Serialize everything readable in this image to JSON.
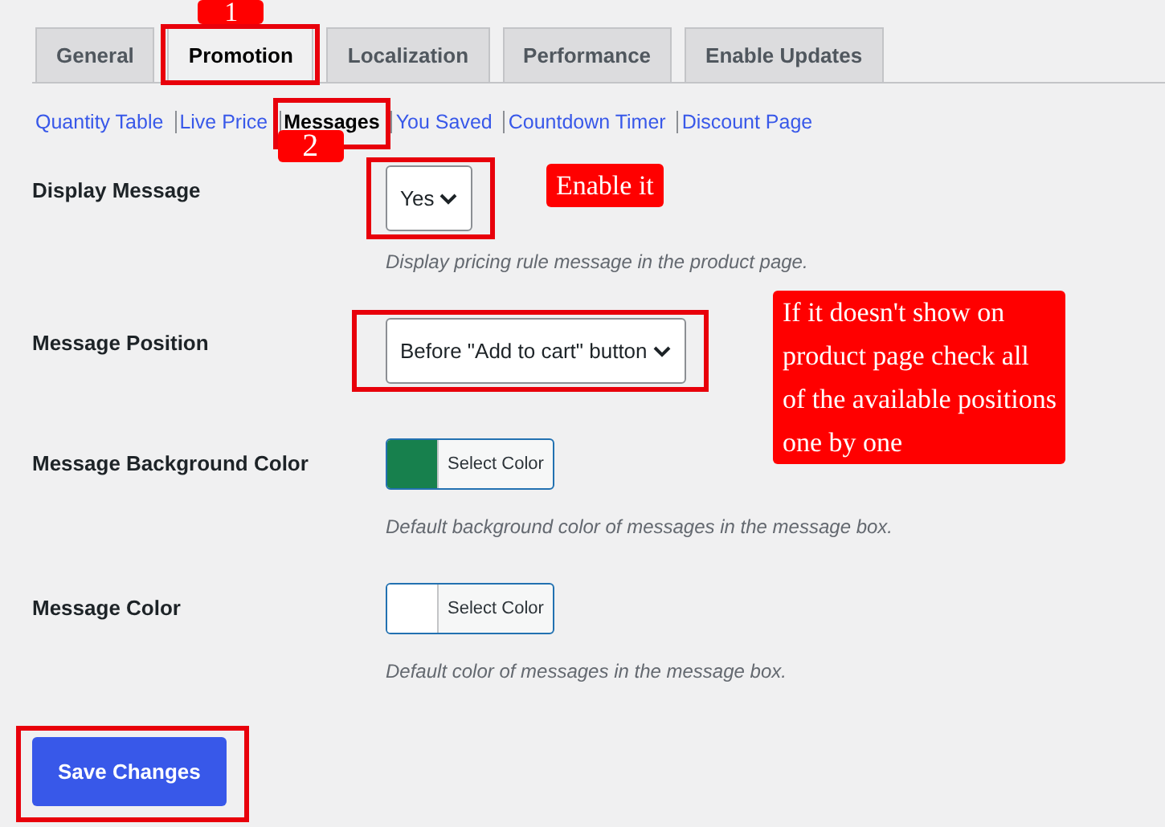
{
  "tabs": [
    {
      "label": "General",
      "selected": false
    },
    {
      "label": "Promotion",
      "selected": true,
      "highlighted": true,
      "callout": "1"
    },
    {
      "label": "Localization",
      "selected": false
    },
    {
      "label": "Performance",
      "selected": false
    },
    {
      "label": "Enable Updates",
      "selected": false
    }
  ],
  "subnav": [
    {
      "label": "Quantity Table",
      "selected": false
    },
    {
      "label": "Live Price",
      "selected": false
    },
    {
      "label": "Messages",
      "selected": true,
      "highlighted": true,
      "callout": "2"
    },
    {
      "label": "You Saved",
      "selected": false
    },
    {
      "label": "Countdown Timer",
      "selected": false
    },
    {
      "label": "Discount Page",
      "selected": false
    }
  ],
  "settings": [
    {
      "kind": "select",
      "label": "Display Message",
      "value": "Yes",
      "description": "Display pricing rule message in the product page.",
      "highlighted": true,
      "callout": "Enable it"
    },
    {
      "kind": "select",
      "label": "Message Position",
      "value": "Before \"Add to cart\" button",
      "highlighted": true,
      "callout": "If it doesn't show on\nproduct page check all\nof the available positions\none by one"
    },
    {
      "kind": "color",
      "label": "Message Background Color",
      "button": "Select Color",
      "color": "#17804d",
      "description": "Default background color of messages in the message box."
    },
    {
      "kind": "color",
      "label": "Message Color",
      "button": "Select Color",
      "color": "#ffffff",
      "description": "Default color of messages in the message box."
    }
  ],
  "save_button": {
    "label": "Save Changes",
    "highlighted": true
  }
}
